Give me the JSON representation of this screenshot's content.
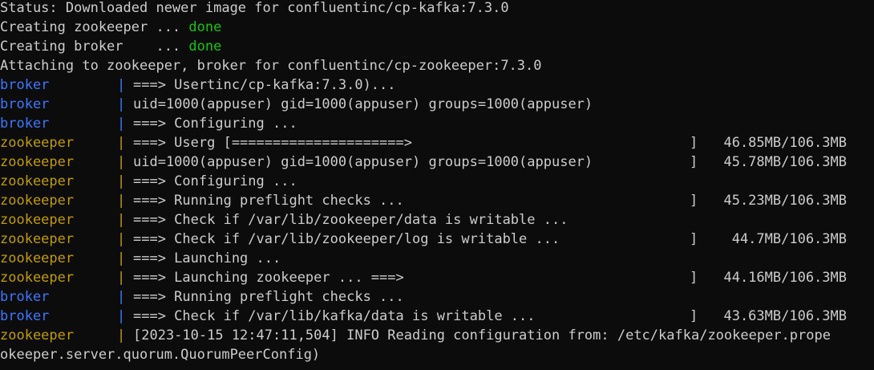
{
  "terminal": {
    "background": "#0c0c0c",
    "foreground": "#cccccc",
    "colors": {
      "done": "#16c60c",
      "broker": "#3b78ff",
      "zookeeper": "#c19c00"
    },
    "header_lines": [
      {
        "text": "Status: Downloaded newer image for confluentinc/cp-kafka:7.3.0"
      },
      {
        "text": "Creating zookeeper ... ",
        "status": "done"
      },
      {
        "text": "Creating broker    ... ",
        "status": "done"
      },
      {
        "text": "Attaching to zookeeper, broker for confluentinc/cp-zookeeper:7.3.0"
      }
    ],
    "log_lines": [
      {
        "service": "broker",
        "pipe": "|",
        "message": "===> Usertinc/cp-kafka:7.3.0)...",
        "bracket": "",
        "size": ""
      },
      {
        "service": "broker",
        "pipe": "|",
        "message": "uid=1000(appuser) gid=1000(appuser) groups=1000(appuser)",
        "bracket": "",
        "size": ""
      },
      {
        "service": "broker",
        "pipe": "|",
        "message": "===> Configuring ...",
        "bracket": "",
        "size": ""
      },
      {
        "service": "zookeeper",
        "pipe": "|",
        "message": "===> Userg [=====================>",
        "bracket": "]",
        "size": "46.85MB/106.3MB"
      },
      {
        "service": "zookeeper",
        "pipe": "|",
        "message": "uid=1000(appuser) gid=1000(appuser) groups=1000(appuser)",
        "bracket": "]",
        "size": "45.78MB/106.3MB"
      },
      {
        "service": "zookeeper",
        "pipe": "|",
        "message": "===> Configuring ...",
        "bracket": "",
        "size": ""
      },
      {
        "service": "zookeeper",
        "pipe": "|",
        "message": "===> Running preflight checks ...",
        "bracket": "]",
        "size": "45.23MB/106.3MB"
      },
      {
        "service": "zookeeper",
        "pipe": "|",
        "message": "===> Check if /var/lib/zookeeper/data is writable ...",
        "bracket": "",
        "size": ""
      },
      {
        "service": "zookeeper",
        "pipe": "|",
        "message": "===> Check if /var/lib/zookeeper/log is writable ...",
        "bracket": "]",
        "size": "44.7MB/106.3MB"
      },
      {
        "service": "zookeeper",
        "pipe": "|",
        "message": "===> Launching ...",
        "bracket": "",
        "size": ""
      },
      {
        "service": "zookeeper",
        "pipe": "|",
        "message": "===> Launching zookeeper ... ===>",
        "bracket": "]",
        "size": "44.16MB/106.3MB"
      },
      {
        "service": "broker",
        "pipe": "|",
        "message": "===> Running preflight checks ...",
        "bracket": "",
        "size": ""
      },
      {
        "service": "broker",
        "pipe": "|",
        "message": "===> Check if /var/lib/kafka/data is writable ...",
        "bracket": "]",
        "size": "43.63MB/106.3MB"
      },
      {
        "service": "zookeeper",
        "pipe": "|",
        "message": "[2023-10-15 12:47:11,504] INFO Reading configuration from: /etc/kafka/zookeeper.prope",
        "bracket": "",
        "size": ""
      }
    ],
    "continuation_line": "okeeper.server.quorum.QuorumPeerConfig)"
  }
}
